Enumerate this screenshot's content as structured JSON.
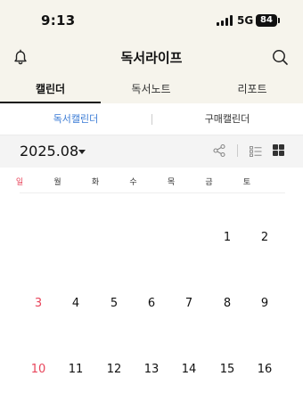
{
  "status": {
    "time": "9:13",
    "network": "5G",
    "battery": "84"
  },
  "header": {
    "title": "독서라이프",
    "left_icon": "bell-icon",
    "right_icon": "search-icon"
  },
  "tabs": [
    {
      "label": "캘린더",
      "active": true
    },
    {
      "label": "독서노트",
      "active": false
    },
    {
      "label": "리포트",
      "active": false
    }
  ],
  "subtabs": [
    {
      "label": "독서캘린더",
      "active": true
    },
    {
      "label": "구매캘린더",
      "active": false
    }
  ],
  "calendar": {
    "month_label": "2025.08",
    "weekdays": [
      "일",
      "월",
      "화",
      "수",
      "목",
      "금",
      "토"
    ],
    "weeks": [
      [
        "",
        "",
        "",
        "",
        "",
        "1",
        "2"
      ],
      [
        "3",
        "4",
        "5",
        "6",
        "7",
        "8",
        "9"
      ],
      [
        "10",
        "11",
        "12",
        "13",
        "14",
        "15",
        "16"
      ]
    ]
  },
  "colors": {
    "header_bg": "#f6f4ec",
    "accent": "#3a7bd5",
    "sunday": "#e8455b"
  }
}
